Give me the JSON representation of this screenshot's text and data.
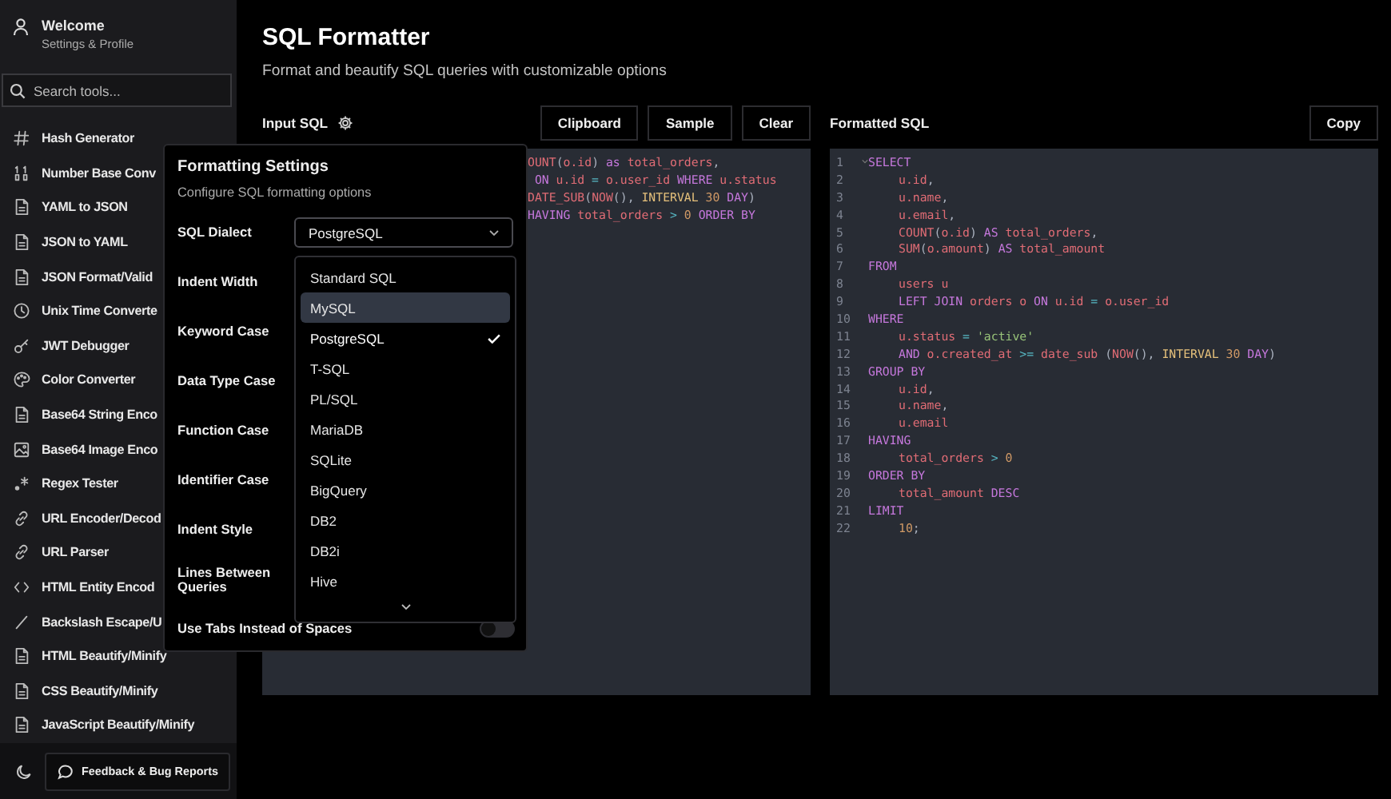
{
  "sidebar": {
    "profile": {
      "title": "Welcome",
      "subtitle": "Settings & Profile"
    },
    "search": {
      "placeholder": "Search tools..."
    },
    "items": [
      {
        "label": "Hash Generator",
        "kind": "hash"
      },
      {
        "label": "Number Base Conv",
        "kind": "binary"
      },
      {
        "label": "YAML to JSON",
        "kind": "file"
      },
      {
        "label": "JSON to YAML",
        "kind": "file"
      },
      {
        "label": "JSON Format/Valid",
        "kind": "file"
      },
      {
        "label": "Unix Time Converte",
        "kind": "clock"
      },
      {
        "label": "JWT Debugger",
        "kind": "key"
      },
      {
        "label": "Color Converter",
        "kind": "palette"
      },
      {
        "label": "Base64 String Enco",
        "kind": "file"
      },
      {
        "label": "Base64 Image Enco",
        "kind": "image"
      },
      {
        "label": "Regex Tester",
        "kind": "regex"
      },
      {
        "label": "URL Encoder/Decod",
        "kind": "link"
      },
      {
        "label": "URL Parser",
        "kind": "link"
      },
      {
        "label": "HTML Entity Encod",
        "kind": "code"
      },
      {
        "label": "Backslash Escape/U",
        "kind": "slash"
      },
      {
        "label": "HTML Beautify/Minify",
        "kind": "file"
      },
      {
        "label": "CSS Beautify/Minify",
        "kind": "file"
      },
      {
        "label": "JavaScript Beautify/Minify",
        "kind": "file"
      }
    ],
    "feedback_button": "Feedback & Bug Reports"
  },
  "header": {
    "title": "SQL Formatter",
    "subtitle": "Format and beautify SQL queries with customizable options"
  },
  "input": {
    "label": "Input SQL",
    "buttons": [
      "Clipboard",
      "Sample",
      "Clear"
    ],
    "lines": [
      {
        "tokens": [
          {
            "text": "OUNT",
            "kind": "ident"
          },
          {
            "text": "(",
            "kind": "punct"
          },
          {
            "text": "o.id",
            "kind": "ident"
          },
          {
            "text": ") ",
            "kind": "punct"
          },
          {
            "text": "as",
            "kind": "keyword"
          },
          {
            "text": " total_orders",
            "kind": "ident"
          },
          {
            "text": ",",
            "kind": "punct"
          }
        ]
      },
      {
        "tokens": [
          {
            "text": " ON",
            "kind": "keyword"
          },
          {
            "text": " u.id",
            "kind": "ident"
          },
          {
            "text": " = ",
            "kind": "op"
          },
          {
            "text": "o.user_id",
            "kind": "ident"
          },
          {
            "text": " WHERE",
            "kind": "keyword"
          },
          {
            "text": " u.status",
            "kind": "ident"
          }
        ]
      },
      {
        "tokens": [
          {
            "text": "DATE_SUB",
            "kind": "ident"
          },
          {
            "text": "(",
            "kind": "punct"
          },
          {
            "text": "NOW",
            "kind": "ident"
          },
          {
            "text": "(), ",
            "kind": "punct"
          },
          {
            "text": "INTERVAL",
            "kind": "type"
          },
          {
            "text": " 30",
            "kind": "number"
          },
          {
            "text": " DAY",
            "kind": "keyword"
          },
          {
            "text": ")",
            "kind": "punct"
          }
        ]
      },
      {
        "tokens": [
          {
            "text": "HAVING",
            "kind": "keyword"
          },
          {
            "text": " total_orders",
            "kind": "ident"
          },
          {
            "text": " > ",
            "kind": "op"
          },
          {
            "text": "0",
            "kind": "number"
          },
          {
            "text": " ORDER BY",
            "kind": "keyword"
          }
        ]
      }
    ]
  },
  "output": {
    "label": "Formatted SQL",
    "buttons": [
      "Copy"
    ],
    "lines": [
      {
        "number": "1",
        "indented": false,
        "foldable": true,
        "tokens": [
          {
            "text": "SELECT",
            "kind": "keyword"
          }
        ]
      },
      {
        "number": "2",
        "indented": true,
        "tokens": [
          {
            "text": "u.id",
            "kind": "ident"
          },
          {
            "text": ",",
            "kind": "punct"
          }
        ]
      },
      {
        "number": "3",
        "indented": true,
        "tokens": [
          {
            "text": "u.name",
            "kind": "ident"
          },
          {
            "text": ",",
            "kind": "punct"
          }
        ]
      },
      {
        "number": "4",
        "indented": true,
        "tokens": [
          {
            "text": "u.email",
            "kind": "ident"
          },
          {
            "text": ",",
            "kind": "punct"
          }
        ]
      },
      {
        "number": "5",
        "indented": true,
        "tokens": [
          {
            "text": "COUNT",
            "kind": "ident"
          },
          {
            "text": "(",
            "kind": "punct"
          },
          {
            "text": "o.id",
            "kind": "ident"
          },
          {
            "text": ") ",
            "kind": "punct"
          },
          {
            "text": "AS",
            "kind": "keyword"
          },
          {
            "text": " total_orders",
            "kind": "ident"
          },
          {
            "text": ",",
            "kind": "punct"
          }
        ]
      },
      {
        "number": "6",
        "indented": true,
        "tokens": [
          {
            "text": "SUM",
            "kind": "ident"
          },
          {
            "text": "(",
            "kind": "punct"
          },
          {
            "text": "o.amount",
            "kind": "ident"
          },
          {
            "text": ") ",
            "kind": "punct"
          },
          {
            "text": "AS",
            "kind": "keyword"
          },
          {
            "text": " total_amount",
            "kind": "ident"
          }
        ]
      },
      {
        "number": "7",
        "indented": false,
        "tokens": [
          {
            "text": "FROM",
            "kind": "keyword"
          }
        ]
      },
      {
        "number": "8",
        "indented": true,
        "tokens": [
          {
            "text": "users u",
            "kind": "ident"
          }
        ]
      },
      {
        "number": "9",
        "indented": true,
        "tokens": [
          {
            "text": "LEFT JOIN",
            "kind": "keyword"
          },
          {
            "text": " orders o",
            "kind": "ident"
          },
          {
            "text": " ON",
            "kind": "keyword"
          },
          {
            "text": " u.id",
            "kind": "ident"
          },
          {
            "text": " = ",
            "kind": "op"
          },
          {
            "text": "o.user_id",
            "kind": "ident"
          }
        ]
      },
      {
        "number": "10",
        "indented": false,
        "tokens": [
          {
            "text": "WHERE",
            "kind": "keyword"
          }
        ]
      },
      {
        "number": "11",
        "indented": true,
        "tokens": [
          {
            "text": "u.status",
            "kind": "ident"
          },
          {
            "text": " = ",
            "kind": "op"
          },
          {
            "text": "'active'",
            "kind": "string"
          }
        ]
      },
      {
        "number": "12",
        "indented": true,
        "tokens": [
          {
            "text": "AND",
            "kind": "keyword"
          },
          {
            "text": " o.created_at",
            "kind": "ident"
          },
          {
            "text": " >= ",
            "kind": "op"
          },
          {
            "text": "date_sub",
            "kind": "ident"
          },
          {
            "text": " (",
            "kind": "punct"
          },
          {
            "text": "NOW",
            "kind": "ident"
          },
          {
            "text": "(), ",
            "kind": "punct"
          },
          {
            "text": "INTERVAL",
            "kind": "type"
          },
          {
            "text": " 30",
            "kind": "number"
          },
          {
            "text": " DAY",
            "kind": "keyword"
          },
          {
            "text": ")",
            "kind": "punct"
          }
        ]
      },
      {
        "number": "13",
        "indented": false,
        "tokens": [
          {
            "text": "GROUP BY",
            "kind": "keyword"
          }
        ]
      },
      {
        "number": "14",
        "indented": true,
        "tokens": [
          {
            "text": "u.id",
            "kind": "ident"
          },
          {
            "text": ",",
            "kind": "punct"
          }
        ]
      },
      {
        "number": "15",
        "indented": true,
        "tokens": [
          {
            "text": "u.name",
            "kind": "ident"
          },
          {
            "text": ",",
            "kind": "punct"
          }
        ]
      },
      {
        "number": "16",
        "indented": true,
        "tokens": [
          {
            "text": "u.email",
            "kind": "ident"
          }
        ]
      },
      {
        "number": "17",
        "indented": false,
        "tokens": [
          {
            "text": "HAVING",
            "kind": "keyword"
          }
        ]
      },
      {
        "number": "18",
        "indented": true,
        "tokens": [
          {
            "text": "total_orders",
            "kind": "ident"
          },
          {
            "text": " > ",
            "kind": "op"
          },
          {
            "text": "0",
            "kind": "number"
          }
        ]
      },
      {
        "number": "19",
        "indented": false,
        "tokens": [
          {
            "text": "ORDER BY",
            "kind": "keyword"
          }
        ]
      },
      {
        "number": "20",
        "indented": true,
        "tokens": [
          {
            "text": "total_amount",
            "kind": "ident"
          },
          {
            "text": " DESC",
            "kind": "keyword"
          }
        ]
      },
      {
        "number": "21",
        "indented": false,
        "tokens": [
          {
            "text": "LIMIT",
            "kind": "keyword"
          }
        ]
      },
      {
        "number": "22",
        "indented": true,
        "tokens": [
          {
            "text": "10",
            "kind": "number"
          },
          {
            "text": ";",
            "kind": "punct"
          }
        ]
      }
    ]
  },
  "settings": {
    "title": "Formatting Settings",
    "subtitle": "Configure SQL formatting options",
    "rows": [
      {
        "label": "SQL Dialect",
        "kind": "select",
        "value": "PostgreSQL",
        "expanded": true
      },
      {
        "label": "Indent Width",
        "kind": "select"
      },
      {
        "label": "Keyword Case",
        "kind": "select"
      },
      {
        "label": "Data Type Case",
        "kind": "select"
      },
      {
        "label": "Function Case",
        "kind": "select"
      },
      {
        "label": "Identifier Case",
        "kind": "select"
      },
      {
        "label": "Indent Style",
        "kind": "select"
      },
      {
        "label": "Lines Between Queries",
        "kind": "select"
      },
      {
        "label": "Use Tabs Instead of Spaces",
        "kind": "toggle",
        "on": false
      }
    ]
  },
  "dialect_menu": {
    "options": [
      {
        "label": "Standard SQL",
        "selected": false,
        "hovered": false
      },
      {
        "label": "MySQL",
        "selected": false,
        "hovered": true
      },
      {
        "label": "PostgreSQL",
        "selected": true,
        "hovered": false
      },
      {
        "label": "T-SQL",
        "selected": false,
        "hovered": false
      },
      {
        "label": "PL/SQL",
        "selected": false,
        "hovered": false
      },
      {
        "label": "MariaDB",
        "selected": false,
        "hovered": false
      },
      {
        "label": "SQLite",
        "selected": false,
        "hovered": false
      },
      {
        "label": "BigQuery",
        "selected": false,
        "hovered": false
      },
      {
        "label": "DB2",
        "selected": false,
        "hovered": false
      },
      {
        "label": "DB2i",
        "selected": false,
        "hovered": false
      },
      {
        "label": "Hive",
        "selected": false,
        "hovered": false
      }
    ]
  }
}
